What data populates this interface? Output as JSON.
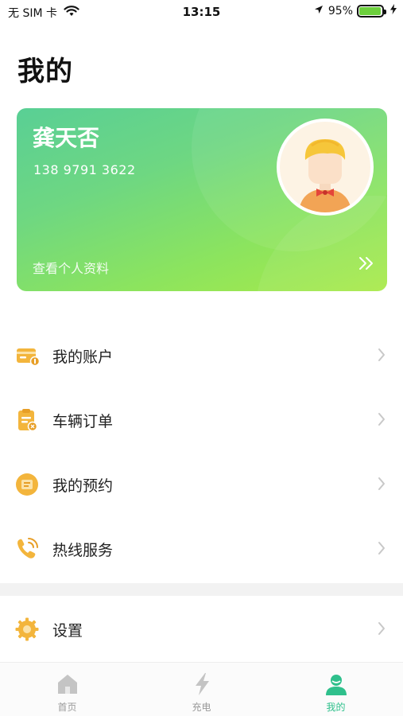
{
  "status_bar": {
    "carrier": "无 SIM 卡",
    "time": "13:15",
    "battery": "95%",
    "battery_level": 0.95
  },
  "page": {
    "title": "我的"
  },
  "profile": {
    "name": "龚天否",
    "phone": "138 9791 3622",
    "view_link": "查看个人资料"
  },
  "menu": {
    "items": [
      {
        "label": "我的账户",
        "icon": "wallet-icon"
      },
      {
        "label": "车辆订单",
        "icon": "order-icon"
      },
      {
        "label": "我的预约",
        "icon": "reservation-icon"
      },
      {
        "label": "热线服务",
        "icon": "phone-icon"
      }
    ],
    "settings": {
      "label": "设置",
      "icon": "gear-icon"
    }
  },
  "tabs": [
    {
      "label": "首页",
      "icon": "home-icon",
      "active": false
    },
    {
      "label": "充电",
      "icon": "lightning-icon",
      "active": false
    },
    {
      "label": "我的",
      "icon": "user-icon",
      "active": true
    }
  ],
  "colors": {
    "accent": "#2fc08c",
    "card_gradient_start": "#59cf95",
    "card_gradient_end": "#a9ea49",
    "icon_orange": "#f3b53c",
    "tab_inactive": "#c4c4c4"
  }
}
